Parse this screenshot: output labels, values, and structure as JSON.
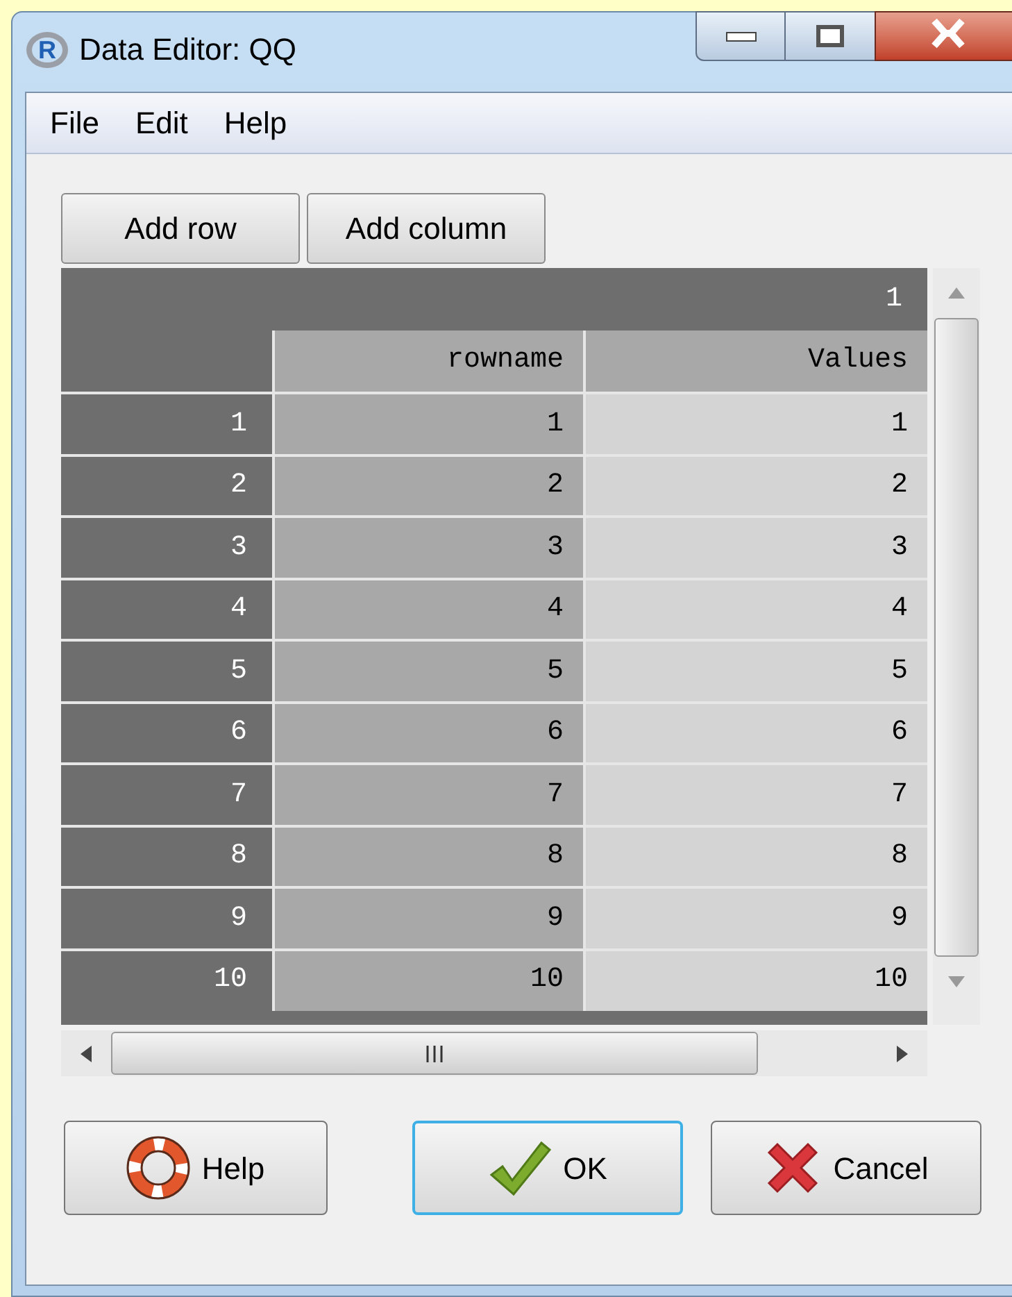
{
  "window": {
    "logo": "R",
    "title": "Data Editor: QQ"
  },
  "menu": [
    "File",
    "Edit",
    "Help"
  ],
  "toolbar": [
    "Add row",
    "Add column"
  ],
  "grid": {
    "column_index": "1",
    "columns": [
      "rowname",
      "Values"
    ],
    "rows": [
      {
        "label": "1",
        "cells": [
          "1",
          "1"
        ]
      },
      {
        "label": "2",
        "cells": [
          "2",
          "2"
        ]
      },
      {
        "label": "3",
        "cells": [
          "3",
          "3"
        ]
      },
      {
        "label": "4",
        "cells": [
          "4",
          "4"
        ]
      },
      {
        "label": "5",
        "cells": [
          "5",
          "5"
        ]
      },
      {
        "label": "6",
        "cells": [
          "6",
          "6"
        ]
      },
      {
        "label": "7",
        "cells": [
          "7",
          "7"
        ]
      },
      {
        "label": "8",
        "cells": [
          "8",
          "8"
        ]
      },
      {
        "label": "9",
        "cells": [
          "9",
          "9"
        ]
      },
      {
        "label": "10",
        "cells": [
          "10",
          "10"
        ]
      }
    ]
  },
  "buttons": [
    {
      "kind": "help",
      "label": "Help",
      "focused": false
    },
    {
      "kind": "ok",
      "label": "OK",
      "focused": true
    },
    {
      "kind": "cancel",
      "label": "Cancel",
      "focused": false
    }
  ]
}
